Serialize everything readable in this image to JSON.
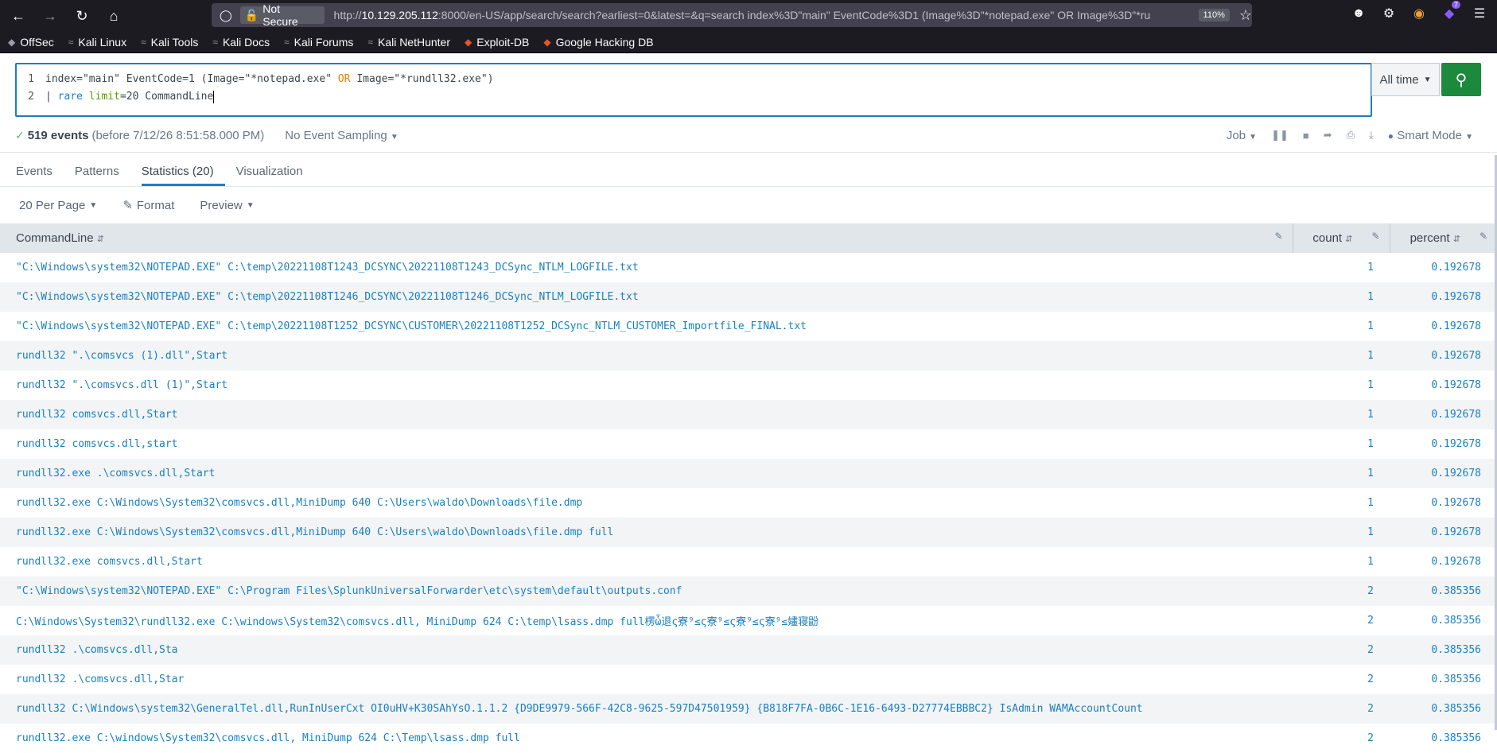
{
  "browser": {
    "not_secure": "Not Secure",
    "url_host": "10.129.205.112",
    "url_prefix": "http://",
    "url_rest": ":8000/en-US/app/search/search?earliest=0&latest=&q=search index%3D\"main\" EventCode%3D1 (Image%3D\"*notepad.exe\" OR Image%3D\"*ru",
    "zoom": "110%",
    "extension_badge": "7",
    "bookmarks": [
      "OffSec",
      "Kali Linux",
      "Kali Tools",
      "Kali Docs",
      "Kali Forums",
      "Kali NetHunter",
      "Exploit-DB",
      "Google Hacking DB"
    ]
  },
  "search": {
    "line1_num": "1",
    "line2_num": "2",
    "line1_a": "index=\"main\" EventCode=1 (Image=\"*notepad.exe\" ",
    "line1_or": "OR",
    "line1_b": " Image=\"*rundll32.exe\")",
    "line2_pipe": "| ",
    "line2_cmd": "rare",
    "line2_arg": "limit",
    "line2_rest": "=20 CommandLine",
    "time_range": "All time"
  },
  "status": {
    "event_count": "519 events",
    "before": "(before 7/12/26 8:51:58.000 PM)",
    "sampling": "No Event Sampling",
    "job": "Job",
    "mode": "Smart Mode"
  },
  "tabs": [
    "Events",
    "Patterns",
    "Statistics (20)",
    "Visualization"
  ],
  "view": {
    "per_page": "20 Per Page",
    "format": "Format",
    "preview": "Preview"
  },
  "table": {
    "headers": [
      "CommandLine",
      "count",
      "percent"
    ],
    "rows": [
      [
        "\"C:\\Windows\\system32\\NOTEPAD.EXE\" C:\\temp\\20221108T1243_DCSYNC\\20221108T1243_DCSync_NTLM_LOGFILE.txt",
        "1",
        "0.192678"
      ],
      [
        "\"C:\\Windows\\system32\\NOTEPAD.EXE\" C:\\temp\\20221108T1246_DCSYNC\\20221108T1246_DCSync_NTLM_LOGFILE.txt",
        "1",
        "0.192678"
      ],
      [
        "\"C:\\Windows\\system32\\NOTEPAD.EXE\" C:\\temp\\20221108T1252_DCSYNC\\CUSTOMER\\20221108T1252_DCSync_NTLM_CUSTOMER_Importfile_FINAL.txt",
        "1",
        "0.192678"
      ],
      [
        "rundll32  \".\\comsvcs (1).dll\",Start",
        "1",
        "0.192678"
      ],
      [
        "rundll32  \".\\comsvcs.dll (1)\",Start",
        "1",
        "0.192678"
      ],
      [
        "rundll32  comsvcs.dll,Start",
        "1",
        "0.192678"
      ],
      [
        "rundll32  comsvcs.dll,start",
        "1",
        "0.192678"
      ],
      [
        "rundll32.exe  .\\comsvcs.dll,Start",
        "1",
        "0.192678"
      ],
      [
        "rundll32.exe  C:\\Windows\\System32\\comsvcs.dll,MiniDump 640 C:\\Users\\waldo\\Downloads\\file.dmp",
        "1",
        "0.192678"
      ],
      [
        "rundll32.exe  C:\\Windows\\System32\\comsvcs.dll,MiniDump 640 C:\\Users\\waldo\\Downloads\\file.dmp full",
        "1",
        "0.192678"
      ],
      [
        "rundll32.exe  comsvcs.dll,Start",
        "1",
        "0.192678"
      ],
      [
        "\"C:\\Windows\\system32\\NOTEPAD.EXE\" C:\\Program Files\\SplunkUniversalForwarder\\etc\\system\\default\\outputs.conf",
        "2",
        "0.385356"
      ],
      [
        "C:\\Windows\\System32\\rundll32.exe  C:\\windows\\System32\\comsvcs.dll, MiniDump 624 C:\\temp\\lsass.dmp full楞ὧ退ς寮⁹≤ς寮⁹≤ς寮⁹≤ς寮⁹≤嫿寝鼢",
        "2",
        "0.385356"
      ],
      [
        "rundll32  .\\comsvcs.dll,Sta",
        "2",
        "0.385356"
      ],
      [
        "rundll32  .\\comsvcs.dll,Star",
        "2",
        "0.385356"
      ],
      [
        "rundll32 C:\\Windows\\system32\\GeneralTel.dll,RunInUserCxt OI0uHV+K30SAhYsO.1.1.2 {D9DE9979-566F-42C8-9625-597D47501959} {B818F7FA-0B6C-1E16-6493-D27774EBBBC2} IsAdmin WAMAccountCount",
        "2",
        "0.385356"
      ],
      [
        "rundll32.exe  C:\\windows\\System32\\comsvcs.dll, MiniDump 624 C:\\Temp\\lsass.dmp full",
        "2",
        "0.385356"
      ]
    ]
  }
}
